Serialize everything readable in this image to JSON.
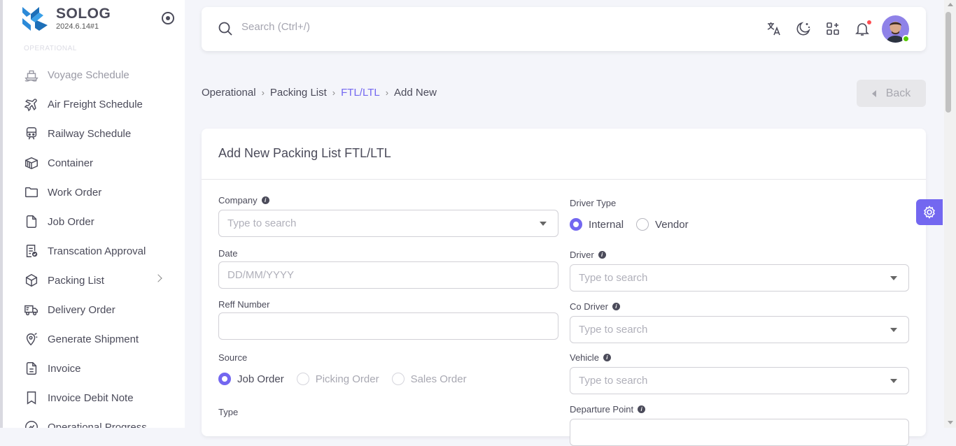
{
  "app": {
    "name": "SOLOG",
    "version": "2024.6.14#1"
  },
  "sidebar": {
    "section_label": "OPERATIONAL",
    "items": [
      {
        "label": "Voyage Schedule",
        "icon": "ship-icon"
      },
      {
        "label": "Air Freight Schedule",
        "icon": "plane-icon"
      },
      {
        "label": "Railway Schedule",
        "icon": "train-icon"
      },
      {
        "label": "Container",
        "icon": "container-icon"
      },
      {
        "label": "Work Order",
        "icon": "folder-icon"
      },
      {
        "label": "Job Order",
        "icon": "file-icon"
      },
      {
        "label": "Transcation Approval",
        "icon": "receipt-check-icon"
      },
      {
        "label": "Packing List",
        "icon": "box-icon"
      },
      {
        "label": "Delivery Order",
        "icon": "truck-icon"
      },
      {
        "label": "Generate Shipment",
        "icon": "map-pin-icon"
      },
      {
        "label": "Invoice",
        "icon": "invoice-icon"
      },
      {
        "label": "Invoice Debit Note",
        "icon": "bookmark-icon"
      },
      {
        "label": "Operational Progress",
        "icon": "progress-icon"
      }
    ]
  },
  "topbar": {
    "search_placeholder": "Search (Ctrl+/)"
  },
  "breadcrumb": {
    "items": [
      "Operational",
      "Packing List",
      "FTL/LTL",
      "Add New"
    ]
  },
  "back_button": {
    "label": "Back"
  },
  "form": {
    "title": "Add New Packing List FTL/LTL",
    "company": {
      "label": "Company",
      "placeholder": "Type to search"
    },
    "date": {
      "label": "Date",
      "placeholder": "DD/MM/YYYY"
    },
    "reff_number": {
      "label": "Reff Number",
      "value": ""
    },
    "source": {
      "label": "Source",
      "options": [
        "Job Order",
        "Picking Order",
        "Sales Order"
      ],
      "selected": "Job Order"
    },
    "type": {
      "label": "Type"
    },
    "driver_type": {
      "label": "Driver Type",
      "options": [
        "Internal",
        "Vendor"
      ],
      "selected": "Internal"
    },
    "driver": {
      "label": "Driver",
      "placeholder": "Type to search"
    },
    "co_driver": {
      "label": "Co Driver",
      "placeholder": "Type to search"
    },
    "vehicle": {
      "label": "Vehicle",
      "placeholder": "Type to search"
    },
    "departure_point": {
      "label": "Departure Point"
    }
  },
  "colors": {
    "accent": "#7367f0",
    "notification": "#ff4c51",
    "online": "#56ca00"
  }
}
